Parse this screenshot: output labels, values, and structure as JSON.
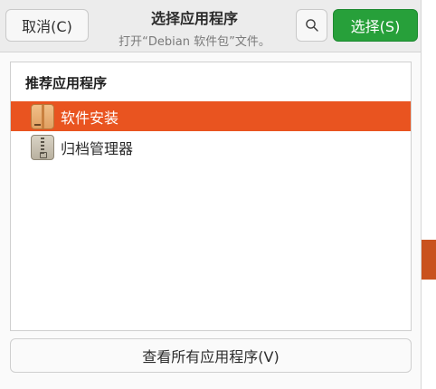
{
  "header": {
    "cancel_label": "取消(C)",
    "title": "选择应用程序",
    "subtitle": "打开“Debian 软件包”文件。",
    "select_label": "选择(S)"
  },
  "app_list": {
    "section_heading": "推荐应用程序",
    "items": [
      {
        "label": "软件安装",
        "icon": "package-icon",
        "selected": true
      },
      {
        "label": "归档管理器",
        "icon": "archive-icon",
        "selected": false
      }
    ]
  },
  "footer": {
    "view_all_label": "查看所有应用程序(V)"
  },
  "colors": {
    "selection": "#e95420",
    "primary_button": "#27a03a"
  }
}
